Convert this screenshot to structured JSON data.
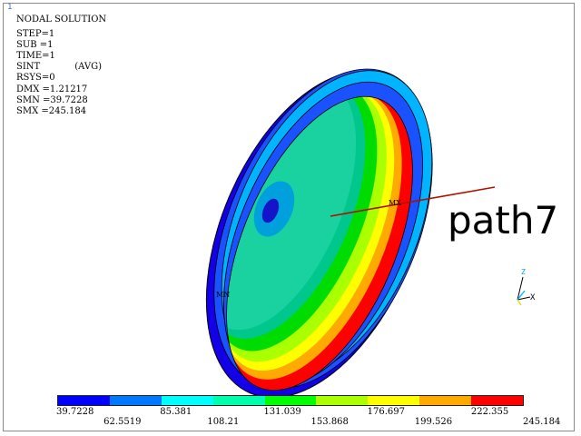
{
  "window_number": "1",
  "solution": {
    "title": "NODAL SOLUTION",
    "lines": [
      {
        "key": "STEP=1"
      },
      {
        "key": "SUB =1"
      },
      {
        "key": "TIME=1"
      },
      {
        "key": "SINT",
        "suffix": "(AVG)"
      },
      {
        "key": "RSYS=0"
      },
      {
        "key": "DMX =1.21217"
      },
      {
        "key": "SMN =39.7228"
      },
      {
        "key": "SMX =245.184"
      }
    ]
  },
  "markers": {
    "mx": "MX",
    "mn": "MN"
  },
  "path_label": "path7",
  "triad": {
    "z": "Z",
    "x": "X"
  },
  "legend": {
    "colors": [
      "#0000ff",
      "#0078ff",
      "#00ffff",
      "#00ffaa",
      "#00ff00",
      "#aaff00",
      "#ffff00",
      "#ffaa00",
      "#ff0000"
    ],
    "top_ticks": [
      "39.7228",
      "85.381",
      "131.039",
      "176.697",
      "222.355"
    ],
    "bottom_ticks": [
      "62.5519",
      "108.21",
      "153.868",
      "199.526",
      "245.184"
    ]
  }
}
